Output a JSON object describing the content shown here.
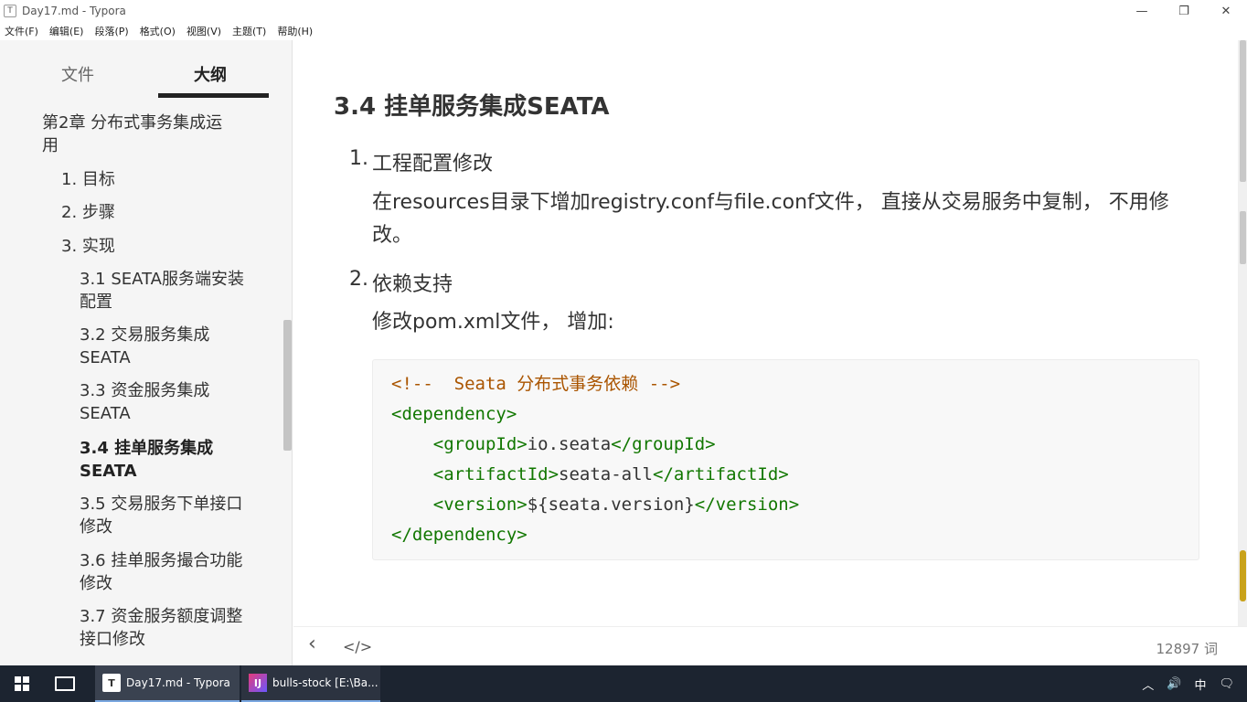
{
  "window": {
    "title": "Day17.md - Typora",
    "app_icon": "T",
    "controls": {
      "minimize": "—",
      "restore": "❐",
      "close": "✕"
    }
  },
  "menu": [
    "文件(F)",
    "编辑(E)",
    "段落(P)",
    "格式(O)",
    "视图(V)",
    "主题(T)",
    "帮助(H)"
  ],
  "sidebar": {
    "tabs": {
      "files": "文件",
      "outline": "大纲"
    },
    "active_tab": "outline",
    "outline": [
      "第2章 分布式事务集成运",
      "用",
      "1. 目标",
      "2. 步骤",
      "3. 实现",
      "3.1 SEATA服务端安装",
      "配置",
      "3.2 交易服务集成",
      "SEATA",
      "3.3 资金服务集成",
      "SEATA",
      "3.4 挂单服务集成",
      "SEATA",
      "3.5 交易服务下单接口",
      "修改",
      "3.6 挂单服务撮合功能",
      "修改",
      "3.7 资金服务额度调整",
      "接口修改"
    ]
  },
  "content": {
    "heading": "3.4  挂单服务集成SEATA",
    "items": [
      {
        "num": "1.",
        "text": "工程配置修改"
      },
      {
        "num": "2.",
        "text": "依赖支持"
      }
    ],
    "para1_line1": "在resources目录下增加registry.conf与file.conf文件， 直接从交易服务中复制， 不用修",
    "para1_line2": "改。",
    "para2": "修改pom.xml文件， 增加:",
    "code": {
      "line1_comment": "<!--  Seata 分布式事务依赖 -->",
      "line2_tag": "<dependency>",
      "line3_open": "<groupId>",
      "line3_text": "io.seata",
      "line3_close": "</groupId>",
      "line4_open": "<artifactId>",
      "line4_text": "seata-all",
      "line4_close": "</artifactId>",
      "line5_open": "<version>",
      "line5_text": "${seata.version}",
      "line5_close": "</version>",
      "line6_tag": "</dependency>"
    }
  },
  "footer": {
    "back_icon": "‹",
    "source_icon": "</>",
    "word_count": "12897 词"
  },
  "taskbar": {
    "apps": [
      {
        "label": "Day17.md - Typora",
        "icon": "T"
      },
      {
        "label": "bulls-stock [E:\\Ba...",
        "icon": "IJ"
      }
    ],
    "tray": {
      "chevron": "︿",
      "volume": "🔊",
      "ime": "中",
      "notification": "🗨"
    }
  },
  "colors": {
    "code_comment": "#aa5500",
    "code_tag": "#117700",
    "taskbar_bg": "#1c2430",
    "sidebar_bg": "#f5f5f5"
  }
}
